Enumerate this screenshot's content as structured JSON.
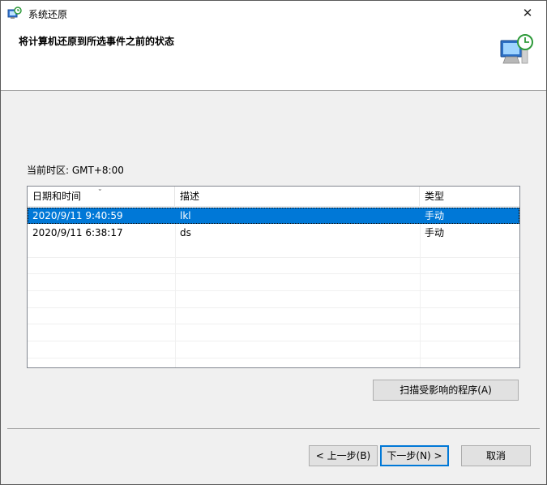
{
  "window": {
    "title": "系统还原",
    "close_glyph": "✕"
  },
  "header": {
    "title": "将计算机还原到所选事件之前的状态",
    "icon": "system-restore-icon"
  },
  "timezone_label": "当前时区: GMT+8:00",
  "table": {
    "columns": [
      "日期和时间",
      "描述",
      "类型"
    ],
    "rows": [
      {
        "datetime": "2020/9/11 9:40:59",
        "description": "lkl",
        "type": "手动",
        "selected": true
      },
      {
        "datetime": "2020/9/11 6:38:17",
        "description": "ds",
        "type": "手动",
        "selected": false
      }
    ]
  },
  "scan_button_label": "扫描受影响的程序(A)",
  "footer": {
    "back_label": "< 上一步(B)",
    "next_label": "下一步(N) >",
    "cancel_label": "取消"
  },
  "colors": {
    "selection": "#0078d7",
    "default_button_border": "#0078d7"
  }
}
